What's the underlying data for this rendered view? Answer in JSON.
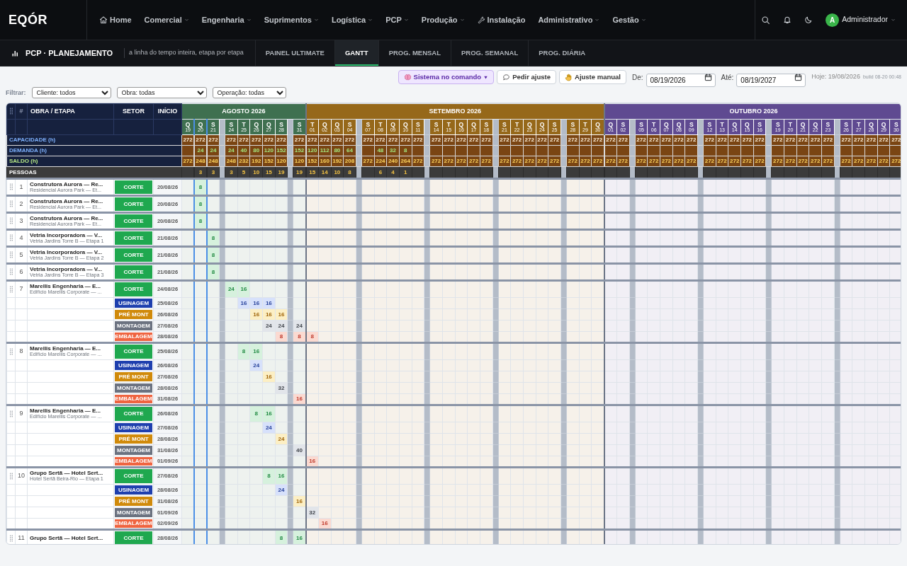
{
  "app": {
    "logo": "EQÓR"
  },
  "nav": [
    {
      "label": "Home",
      "kind": "iconic",
      "dropdown": false
    },
    {
      "label": "Comercial",
      "kind": "menu",
      "dropdown": true
    },
    {
      "label": "Engenharia",
      "kind": "menu",
      "dropdown": true
    },
    {
      "label": "Suprimentos",
      "kind": "menu",
      "dropdown": true
    },
    {
      "label": "Logística",
      "kind": "menu",
      "dropdown": true
    },
    {
      "label": "PCP",
      "kind": "menu",
      "dropdown": true
    },
    {
      "label": "Produção",
      "kind": "menu",
      "dropdown": true
    },
    {
      "label": "Instalação",
      "kind": "iconic",
      "dropdown": false
    },
    {
      "label": "Administrativo",
      "kind": "menu",
      "dropdown": true
    },
    {
      "label": "Gestão",
      "kind": "menu",
      "dropdown": true
    }
  ],
  "user": {
    "initial": "A",
    "name": "Administrador"
  },
  "module": {
    "title": "PCP · PLANEJAMENTO",
    "subtitle": "a linha do tempo inteira, etapa por etapa"
  },
  "tabs": [
    {
      "label": "PAINEL ULTIMATE",
      "selected": false
    },
    {
      "label": "GANTT",
      "selected": true
    },
    {
      "label": "PROG. MENSAL",
      "selected": false
    },
    {
      "label": "PROG. SEMANAL",
      "selected": false
    },
    {
      "label": "PROG. DIÁRIA",
      "selected": false
    }
  ],
  "toolbar": {
    "buttons": [
      {
        "label": "Sistema no comando",
        "kind": "mode",
        "dropdown": true
      },
      {
        "label": "Pedir ajuste",
        "kind": "plain",
        "dropdown": false
      },
      {
        "label": "Ajuste manual",
        "kind": "plain",
        "dropdown": false
      }
    ],
    "from_label": "De:",
    "from": "08/19/2026",
    "to_label": "Até:",
    "to": "08/19/2027",
    "today": "Hoje: 19/08/2026",
    "build": "build 08-20 00:48"
  },
  "filters": {
    "label": "Filtrar:",
    "selects": [
      "Cliente: todos",
      "Obra: todas",
      "Operação: todas"
    ]
  },
  "gantt": {
    "columns": {
      "num": "#",
      "work": "OBRA / ETAPA",
      "sector": "SETOR",
      "start": "INÍCIO"
    },
    "stat_labels": {
      "capacity": "CAPACIDADE (h)",
      "demand": "DEMANDA (h)",
      "balance": "SALDO (h)",
      "people": "PESSOAS"
    },
    "months": [
      {
        "label": "AGOSTO 2026",
        "color": "#3f7050",
        "weeks": [
          [
            {
              "letter": "Q",
              "number": "19",
              "highlighted": false,
              "capacity": "272",
              "balance": "272"
            },
            {
              "letter": "Q",
              "number": "20",
              "highlighted": true,
              "capacity": "272",
              "demand": "24",
              "balance": "248",
              "people": "3"
            },
            {
              "letter": "S",
              "number": "21",
              "highlighted": false,
              "capacity": "272",
              "demand": "24",
              "balance": "248",
              "people": "3"
            }
          ],
          [
            {
              "letter": "S",
              "number": "24",
              "highlighted": false,
              "capacity": "272",
              "demand": "24",
              "balance": "248",
              "people": "3"
            },
            {
              "letter": "T",
              "number": "25",
              "highlighted": false,
              "capacity": "272",
              "demand": "40",
              "balance": "232",
              "people": "5"
            },
            {
              "letter": "Q",
              "number": "26",
              "highlighted": false,
              "capacity": "272",
              "demand": "80",
              "balance": "192",
              "people": "10"
            },
            {
              "letter": "Q",
              "number": "27",
              "highlighted": false,
              "capacity": "272",
              "demand": "120",
              "balance": "152",
              "people": "15"
            },
            {
              "letter": "S",
              "number": "28",
              "highlighted": false,
              "capacity": "272",
              "demand": "152",
              "balance": "120",
              "people": "19"
            }
          ],
          [
            {
              "letter": "S",
              "number": "31",
              "highlighted": false,
              "capacity": "272",
              "demand": "152",
              "balance": "120",
              "people": "19"
            }
          ]
        ]
      },
      {
        "label": "SETEMBRO 2026",
        "color": "#96681a",
        "weeks": [
          [
            {
              "letter": "T",
              "number": "01",
              "highlighted": false,
              "capacity": "272",
              "demand": "120",
              "balance": "152",
              "people": "15"
            },
            {
              "letter": "Q",
              "number": "02",
              "highlighted": false,
              "capacity": "272",
              "demand": "112",
              "balance": "160",
              "people": "14"
            },
            {
              "letter": "Q",
              "number": "03",
              "highlighted": false,
              "capacity": "272",
              "demand": "80",
              "balance": "192",
              "people": "10"
            },
            {
              "letter": "S",
              "number": "04",
              "highlighted": false,
              "capacity": "272",
              "demand": "64",
              "balance": "208",
              "people": "8"
            }
          ],
          [
            {
              "letter": "S",
              "number": "07",
              "highlighted": false,
              "capacity": "272",
              "balance": "272"
            },
            {
              "letter": "T",
              "number": "08",
              "highlighted": false,
              "capacity": "272",
              "demand": "48",
              "balance": "224",
              "people": "6"
            },
            {
              "letter": "Q",
              "number": "09",
              "highlighted": false,
              "capacity": "272",
              "demand": "32",
              "balance": "240",
              "people": "4"
            },
            {
              "letter": "Q",
              "number": "10",
              "highlighted": false,
              "capacity": "272",
              "demand": "8",
              "balance": "264",
              "people": "1"
            },
            {
              "letter": "S",
              "number": "11",
              "highlighted": false,
              "capacity": "272",
              "balance": "272"
            }
          ],
          [
            {
              "letter": "S",
              "number": "14",
              "highlighted": false,
              "capacity": "272",
              "balance": "272"
            },
            {
              "letter": "T",
              "number": "15",
              "highlighted": false,
              "capacity": "272",
              "balance": "272"
            },
            {
              "letter": "Q",
              "number": "16",
              "highlighted": false,
              "capacity": "272",
              "balance": "272"
            },
            {
              "letter": "Q",
              "number": "17",
              "highlighted": false,
              "capacity": "272",
              "balance": "272"
            },
            {
              "letter": "S",
              "number": "18",
              "highlighted": false,
              "capacity": "272",
              "balance": "272"
            }
          ],
          [
            {
              "letter": "S",
              "number": "21",
              "highlighted": false,
              "capacity": "272",
              "balance": "272"
            },
            {
              "letter": "T",
              "number": "22",
              "highlighted": false,
              "capacity": "272",
              "balance": "272"
            },
            {
              "letter": "Q",
              "number": "23",
              "highlighted": false,
              "capacity": "272",
              "balance": "272"
            },
            {
              "letter": "Q",
              "number": "24",
              "highlighted": false,
              "capacity": "272",
              "balance": "272"
            },
            {
              "letter": "S",
              "number": "25",
              "highlighted": false,
              "capacity": "272",
              "balance": "272"
            }
          ],
          [
            {
              "letter": "S",
              "number": "28",
              "highlighted": false,
              "capacity": "272",
              "balance": "272"
            },
            {
              "letter": "T",
              "number": "29",
              "highlighted": false,
              "capacity": "272",
              "balance": "272"
            },
            {
              "letter": "Q",
              "number": "30",
              "highlighted": false,
              "capacity": "272",
              "balance": "272"
            }
          ]
        ]
      },
      {
        "label": "OUTUBRO 2026",
        "color": "#5f4a91",
        "weeks": [
          [
            {
              "letter": "Q",
              "number": "01",
              "highlighted": false,
              "capacity": "272",
              "balance": "272"
            },
            {
              "letter": "S",
              "number": "02",
              "highlighted": false,
              "capacity": "272",
              "balance": "272"
            }
          ],
          [
            {
              "letter": "S",
              "number": "05",
              "highlighted": false,
              "capacity": "272",
              "balance": "272"
            },
            {
              "letter": "T",
              "number": "06",
              "highlighted": false,
              "capacity": "272",
              "balance": "272"
            },
            {
              "letter": "Q",
              "number": "07",
              "highlighted": false,
              "capacity": "272",
              "balance": "272"
            },
            {
              "letter": "Q",
              "number": "08",
              "highlighted": false,
              "capacity": "272",
              "balance": "272"
            },
            {
              "letter": "S",
              "number": "09",
              "highlighted": false,
              "capacity": "272",
              "balance": "272"
            }
          ],
          [
            {
              "letter": "S",
              "number": "12",
              "highlighted": false,
              "capacity": "272",
              "balance": "272"
            },
            {
              "letter": "T",
              "number": "13",
              "highlighted": false,
              "capacity": "272",
              "balance": "272"
            },
            {
              "letter": "Q",
              "number": "14",
              "highlighted": false,
              "capacity": "272",
              "balance": "272"
            },
            {
              "letter": "Q",
              "number": "15",
              "highlighted": false,
              "capacity": "272",
              "balance": "272"
            },
            {
              "letter": "S",
              "number": "16",
              "highlighted": false,
              "capacity": "272",
              "balance": "272"
            }
          ],
          [
            {
              "letter": "S",
              "number": "19",
              "highlighted": false,
              "capacity": "272",
              "balance": "272"
            },
            {
              "letter": "T",
              "number": "20",
              "highlighted": false,
              "capacity": "272",
              "balance": "272"
            },
            {
              "letter": "Q",
              "number": "21",
              "highlighted": false,
              "capacity": "272",
              "balance": "272"
            },
            {
              "letter": "Q",
              "number": "22",
              "highlighted": false,
              "capacity": "272",
              "balance": "272"
            },
            {
              "letter": "S",
              "number": "23",
              "highlighted": false,
              "capacity": "272",
              "balance": "272"
            }
          ],
          [
            {
              "letter": "S",
              "number": "26",
              "highlighted": false,
              "capacity": "272",
              "balance": "272"
            },
            {
              "letter": "T",
              "number": "27",
              "highlighted": false,
              "capacity": "272",
              "balance": "272"
            },
            {
              "letter": "Q",
              "number": "28",
              "highlighted": false,
              "capacity": "272",
              "balance": "272"
            },
            {
              "letter": "Q",
              "number": "29",
              "highlighted": false,
              "capacity": "272",
              "balance": "272"
            },
            {
              "letter": "S",
              "number": "30",
              "highlighted": false,
              "capacity": "272",
              "balance": "272"
            }
          ]
        ]
      }
    ],
    "projects": [
      {
        "number": "1",
        "title": "Construtora Aurora — Re...",
        "subtitle": "Residencial Aurora Park — Et...",
        "stages": [
          {
            "kind": "corte",
            "sector": "CORTE",
            "start": "20/08/26",
            "hours": [
              {
                "filled": false
              },
              {
                "filled": true,
                "value": "8"
              }
            ]
          }
        ]
      },
      {
        "number": "2",
        "title": "Construtora Aurora — Re...",
        "subtitle": "Residencial Aurora Park — Et...",
        "stages": [
          {
            "kind": "corte",
            "sector": "CORTE",
            "start": "20/08/26",
            "hours": [
              {
                "filled": false
              },
              {
                "filled": true,
                "value": "8"
              }
            ]
          }
        ]
      },
      {
        "number": "3",
        "title": "Construtora Aurora — Re...",
        "subtitle": "Residencial Aurora Park — Et...",
        "stages": [
          {
            "kind": "corte",
            "sector": "CORTE",
            "start": "20/08/26",
            "hours": [
              {
                "filled": false
              },
              {
                "filled": true,
                "value": "8"
              }
            ]
          }
        ]
      },
      {
        "number": "4",
        "title": "Vetria Incorporadora — V...",
        "subtitle": "Vetria Jardins Torre B — Etapa 1",
        "stages": [
          {
            "kind": "corte",
            "sector": "CORTE",
            "start": "21/08/26",
            "hours": [
              {
                "filled": false
              },
              {
                "filled": false
              },
              {
                "filled": true,
                "value": "8"
              }
            ]
          }
        ]
      },
      {
        "number": "5",
        "title": "Vetria Incorporadora — V...",
        "subtitle": "Vetria Jardins Torre B — Etapa 2",
        "stages": [
          {
            "kind": "corte",
            "sector": "CORTE",
            "start": "21/08/26",
            "hours": [
              {
                "filled": false
              },
              {
                "filled": false
              },
              {
                "filled": true,
                "value": "8"
              }
            ]
          }
        ]
      },
      {
        "number": "6",
        "title": "Vetria Incorporadora — V...",
        "subtitle": "Vetria Jardins Torre B — Etapa 3",
        "stages": [
          {
            "kind": "corte",
            "sector": "CORTE",
            "start": "21/08/26",
            "hours": [
              {
                "filled": false
              },
              {
                "filled": false
              },
              {
                "filled": true,
                "value": "8"
              }
            ]
          }
        ]
      },
      {
        "number": "7",
        "title": "Marellis Engenharia — E...",
        "subtitle": "Edifício Marellis Corporate — ...",
        "stages": [
          {
            "kind": "corte",
            "sector": "CORTE",
            "start": "24/08/26",
            "hours": [
              {
                "filled": false
              },
              {
                "filled": false
              },
              {
                "filled": false
              },
              {
                "filled": true,
                "value": "24"
              },
              {
                "filled": true,
                "value": "16"
              }
            ]
          },
          {
            "kind": "usinagem",
            "sector": "USINAGEM",
            "start": "25/08/26",
            "hours": [
              {
                "filled": false
              },
              {
                "filled": false
              },
              {
                "filled": false
              },
              {
                "filled": false
              },
              {
                "filled": true,
                "value": "16"
              },
              {
                "filled": true,
                "value": "16"
              },
              {
                "filled": true,
                "value": "16"
              }
            ]
          },
          {
            "kind": "premont",
            "sector": "PRÉ MONT",
            "start": "26/08/26",
            "hours": [
              {
                "filled": false
              },
              {
                "filled": false
              },
              {
                "filled": false
              },
              {
                "filled": false
              },
              {
                "filled": false
              },
              {
                "filled": true,
                "value": "16"
              },
              {
                "filled": true,
                "value": "16"
              },
              {
                "filled": true,
                "value": "16"
              }
            ]
          },
          {
            "kind": "montagem",
            "sector": "MONTAGEM",
            "start": "27/08/26",
            "hours": [
              {
                "filled": false
              },
              {
                "filled": false
              },
              {
                "filled": false
              },
              {
                "filled": false
              },
              {
                "filled": false
              },
              {
                "filled": false
              },
              {
                "filled": true,
                "value": "24"
              },
              {
                "filled": true,
                "value": "24"
              },
              {
                "filled": true,
                "value": "24"
              }
            ]
          },
          {
            "kind": "embalagem",
            "sector": "EMBALAGEM",
            "start": "28/08/26",
            "hours": [
              {
                "filled": false
              },
              {
                "filled": false
              },
              {
                "filled": false
              },
              {
                "filled": false
              },
              {
                "filled": false
              },
              {
                "filled": false
              },
              {
                "filled": false
              },
              {
                "filled": true,
                "value": "8"
              },
              {
                "filled": true,
                "value": "8"
              },
              {
                "filled": true,
                "value": "8"
              }
            ]
          }
        ]
      },
      {
        "number": "8",
        "title": "Marellis Engenharia — E...",
        "subtitle": "Edifício Marellis Corporate — ...",
        "stages": [
          {
            "kind": "corte",
            "sector": "CORTE",
            "start": "25/08/26",
            "hours": [
              {
                "filled": false
              },
              {
                "filled": false
              },
              {
                "filled": false
              },
              {
                "filled": false
              },
              {
                "filled": true,
                "value": "8"
              },
              {
                "filled": true,
                "value": "16"
              }
            ]
          },
          {
            "kind": "usinagem",
            "sector": "USINAGEM",
            "start": "26/08/26",
            "hours": [
              {
                "filled": false
              },
              {
                "filled": false
              },
              {
                "filled": false
              },
              {
                "filled": false
              },
              {
                "filled": false
              },
              {
                "filled": true,
                "value": "24"
              }
            ]
          },
          {
            "kind": "premont",
            "sector": "PRÉ MONT",
            "start": "27/08/26",
            "hours": [
              {
                "filled": false
              },
              {
                "filled": false
              },
              {
                "filled": false
              },
              {
                "filled": false
              },
              {
                "filled": false
              },
              {
                "filled": false
              },
              {
                "filled": true,
                "value": "16"
              }
            ]
          },
          {
            "kind": "montagem",
            "sector": "MONTAGEM",
            "start": "28/08/26",
            "hours": [
              {
                "filled": false
              },
              {
                "filled": false
              },
              {
                "filled": false
              },
              {
                "filled": false
              },
              {
                "filled": false
              },
              {
                "filled": false
              },
              {
                "filled": false
              },
              {
                "filled": true,
                "value": "32"
              }
            ]
          },
          {
            "kind": "embalagem",
            "sector": "EMBALAGEM",
            "start": "31/08/26",
            "hours": [
              {
                "filled": false
              },
              {
                "filled": false
              },
              {
                "filled": false
              },
              {
                "filled": false
              },
              {
                "filled": false
              },
              {
                "filled": false
              },
              {
                "filled": false
              },
              {
                "filled": false
              },
              {
                "filled": true,
                "value": "16"
              }
            ]
          }
        ]
      },
      {
        "number": "9",
        "title": "Marellis Engenharia — E...",
        "subtitle": "Edifício Marellis Corporate — ...",
        "stages": [
          {
            "kind": "corte",
            "sector": "CORTE",
            "start": "26/08/26",
            "hours": [
              {
                "filled": false
              },
              {
                "filled": false
              },
              {
                "filled": false
              },
              {
                "filled": false
              },
              {
                "filled": false
              },
              {
                "filled": true,
                "value": "8"
              },
              {
                "filled": true,
                "value": "16"
              }
            ]
          },
          {
            "kind": "usinagem",
            "sector": "USINAGEM",
            "start": "27/08/26",
            "hours": [
              {
                "filled": false
              },
              {
                "filled": false
              },
              {
                "filled": false
              },
              {
                "filled": false
              },
              {
                "filled": false
              },
              {
                "filled": false
              },
              {
                "filled": true,
                "value": "24"
              }
            ]
          },
          {
            "kind": "premont",
            "sector": "PRÉ MONT",
            "start": "28/08/26",
            "hours": [
              {
                "filled": false
              },
              {
                "filled": false
              },
              {
                "filled": false
              },
              {
                "filled": false
              },
              {
                "filled": false
              },
              {
                "filled": false
              },
              {
                "filled": false
              },
              {
                "filled": true,
                "value": "24"
              }
            ]
          },
          {
            "kind": "montagem",
            "sector": "MONTAGEM",
            "start": "31/08/26",
            "hours": [
              {
                "filled": false
              },
              {
                "filled": false
              },
              {
                "filled": false
              },
              {
                "filled": false
              },
              {
                "filled": false
              },
              {
                "filled": false
              },
              {
                "filled": false
              },
              {
                "filled": false
              },
              {
                "filled": true,
                "value": "40"
              }
            ]
          },
          {
            "kind": "embalagem",
            "sector": "EMBALAGEM",
            "start": "01/09/26",
            "hours": [
              {
                "filled": false
              },
              {
                "filled": false
              },
              {
                "filled": false
              },
              {
                "filled": false
              },
              {
                "filled": false
              },
              {
                "filled": false
              },
              {
                "filled": false
              },
              {
                "filled": false
              },
              {
                "filled": false
              },
              {
                "filled": true,
                "value": "16"
              }
            ]
          }
        ]
      },
      {
        "number": "10",
        "title": "Grupo Sertã — Hotel Sert...",
        "subtitle": "Hotel Sertã Beira-Rio — Etapa 1",
        "stages": [
          {
            "kind": "corte",
            "sector": "CORTE",
            "start": "27/08/26",
            "hours": [
              {
                "filled": false
              },
              {
                "filled": false
              },
              {
                "filled": false
              },
              {
                "filled": false
              },
              {
                "filled": false
              },
              {
                "filled": false
              },
              {
                "filled": true,
                "value": "8"
              },
              {
                "filled": true,
                "value": "16"
              }
            ]
          },
          {
            "kind": "usinagem",
            "sector": "USINAGEM",
            "start": "28/08/26",
            "hours": [
              {
                "filled": false
              },
              {
                "filled": false
              },
              {
                "filled": false
              },
              {
                "filled": false
              },
              {
                "filled": false
              },
              {
                "filled": false
              },
              {
                "filled": false
              },
              {
                "filled": true,
                "value": "24"
              }
            ]
          },
          {
            "kind": "premont",
            "sector": "PRÉ MONT",
            "start": "31/08/26",
            "hours": [
              {
                "filled": false
              },
              {
                "filled": false
              },
              {
                "filled": false
              },
              {
                "filled": false
              },
              {
                "filled": false
              },
              {
                "filled": false
              },
              {
                "filled": false
              },
              {
                "filled": false
              },
              {
                "filled": true,
                "value": "16"
              }
            ]
          },
          {
            "kind": "montagem",
            "sector": "MONTAGEM",
            "start": "01/09/26",
            "hours": [
              {
                "filled": false
              },
              {
                "filled": false
              },
              {
                "filled": false
              },
              {
                "filled": false
              },
              {
                "filled": false
              },
              {
                "filled": false
              },
              {
                "filled": false
              },
              {
                "filled": false
              },
              {
                "filled": false
              },
              {
                "filled": true,
                "value": "32"
              }
            ]
          },
          {
            "kind": "embalagem",
            "sector": "EMBALAGEM",
            "start": "02/09/26",
            "hours": [
              {
                "filled": false
              },
              {
                "filled": false
              },
              {
                "filled": false
              },
              {
                "filled": false
              },
              {
                "filled": false
              },
              {
                "filled": false
              },
              {
                "filled": false
              },
              {
                "filled": false
              },
              {
                "filled": false
              },
              {
                "filled": false
              },
              {
                "filled": true,
                "value": "16"
              }
            ]
          }
        ]
      },
      {
        "number": "11",
        "title": "Grupo Sertã — Hotel Sert...",
        "stages": [
          {
            "kind": "corte",
            "sector": "CORTE",
            "start": "28/08/26",
            "hours": [
              {
                "filled": false
              },
              {
                "filled": false
              },
              {
                "filled": false
              },
              {
                "filled": false
              },
              {
                "filled": false
              },
              {
                "filled": false
              },
              {
                "filled": false
              },
              {
                "filled": true,
                "value": "8"
              },
              {
                "filled": true,
                "value": "16"
              }
            ]
          }
        ]
      }
    ]
  }
}
